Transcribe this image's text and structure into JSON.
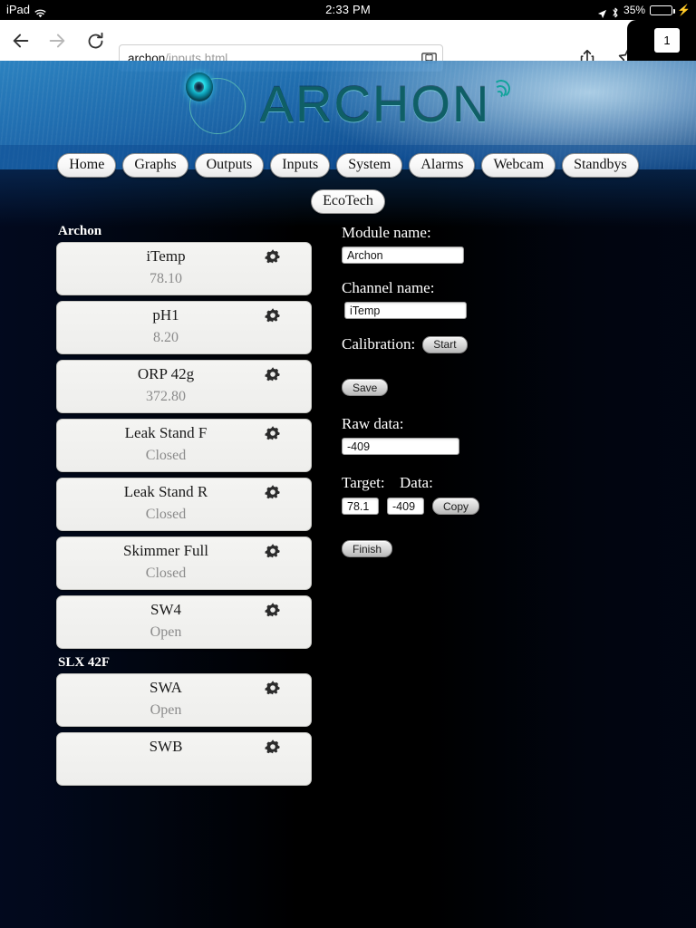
{
  "status_bar": {
    "device": "iPad",
    "wifi_icon": "wifi-icon",
    "time": "2:33 PM",
    "location_icon": "location-arrow-icon",
    "bluetooth_icon": "bluetooth-icon",
    "battery_percent": "35%",
    "battery_fill_color": "#4cd964",
    "charging_icon": "lightning-bolt-icon"
  },
  "browser": {
    "back_icon": "back-arrow-icon",
    "forward_icon": "forward-arrow-icon",
    "reload_icon": "reload-icon",
    "url_host": "archon",
    "url_path": "/inputs.html",
    "reader_icon": "reader-view-icon",
    "share_icon": "share-icon",
    "bookmark_icon": "bookmark-star-icon",
    "tab_count": "1"
  },
  "header": {
    "brand": "ARCHON",
    "logo_icon": "archon-logo-icon",
    "wifi_waves_icon": "signal-waves-icon",
    "brand_color": "#0f5f66"
  },
  "nav": {
    "row1": [
      {
        "label": "Home"
      },
      {
        "label": "Graphs"
      },
      {
        "label": "Outputs"
      },
      {
        "label": "Inputs"
      },
      {
        "label": "System"
      },
      {
        "label": "Alarms"
      },
      {
        "label": "Webcam"
      },
      {
        "label": "Standbys"
      }
    ],
    "row2": [
      {
        "label": "EcoTech"
      }
    ]
  },
  "channel_list": {
    "groups": [
      {
        "title": "Archon",
        "items": [
          {
            "name": "iTemp",
            "value": "78.10",
            "gear_icon": "gear-icon"
          },
          {
            "name": "pH1",
            "value": "8.20",
            "gear_icon": "gear-icon"
          },
          {
            "name": "ORP 42g",
            "value": "372.80",
            "gear_icon": "gear-icon"
          },
          {
            "name": "Leak Stand F",
            "value": "Closed",
            "gear_icon": "gear-icon"
          },
          {
            "name": "Leak Stand R",
            "value": "Closed",
            "gear_icon": "gear-icon"
          },
          {
            "name": "Skimmer Full",
            "value": "Closed",
            "gear_icon": "gear-icon"
          },
          {
            "name": "SW4",
            "value": "Open",
            "gear_icon": "gear-icon"
          }
        ]
      },
      {
        "title": "SLX 42F",
        "items": [
          {
            "name": "SWA",
            "value": "Open",
            "gear_icon": "gear-icon"
          },
          {
            "name": "SWB",
            "value": "",
            "gear_icon": "gear-icon"
          }
        ]
      }
    ]
  },
  "form": {
    "module_name_label": "Module name:",
    "module_name_value": "Archon",
    "channel_name_label": "Channel name:",
    "channel_name_value": "iTemp",
    "calibration_label": "Calibration:",
    "start_button": "Start",
    "save_button": "Save",
    "raw_data_label": "Raw data:",
    "raw_data_value": "-409",
    "target_label": "Target:",
    "data_label": "Data:",
    "target_value": "78.1",
    "data_value": "-409",
    "copy_button": "Copy",
    "finish_button": "Finish"
  }
}
